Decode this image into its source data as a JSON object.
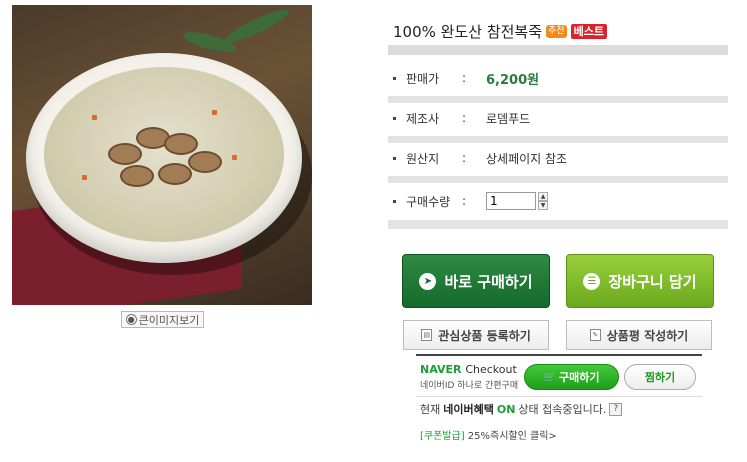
{
  "product": {
    "title": "100% 완도산 참전복죽",
    "badge_recommend": "추천",
    "badge_best": "베스트",
    "zoom_label": "큰이미지보기",
    "zoom_icon": "magnifier-pin-icon"
  },
  "info": [
    {
      "label": "판매가",
      "colon": ":",
      "value": "6,200원"
    },
    {
      "label": "제조사",
      "colon": ":",
      "value": "로뎀푸드"
    },
    {
      "label": "원산지",
      "colon": ":",
      "value": "상세페이지 참조"
    },
    {
      "label": "구매수량",
      "colon": ":",
      "value": "1"
    }
  ],
  "actions": {
    "buy_now": "바로 구매하기",
    "add_cart": "장바구니 담기",
    "wishlist": "관심상품 등록하기",
    "review": "상품평 작성하기"
  },
  "naver": {
    "brand": "NAVER",
    "checkout": "Checkout",
    "subtitle": "네이버ID 하나로 간편구매",
    "buy_label": "구매하기",
    "wish_label": "찜하기",
    "benefit_prefix": "현재",
    "benefit_brand": "네이버혜택",
    "benefit_on": "ON",
    "benefit_suffix": "상태 접속중입니다.",
    "help": "?",
    "coupon_tag": "[쿠폰발급]",
    "coupon_text": "25%즉시할인 클릭>"
  },
  "colors": {
    "price": "#2d7a3e",
    "buy_button": "#156a2b",
    "cart_button": "#6aa81d",
    "naver_green": "#1aa033",
    "best_badge": "#d6262b"
  }
}
